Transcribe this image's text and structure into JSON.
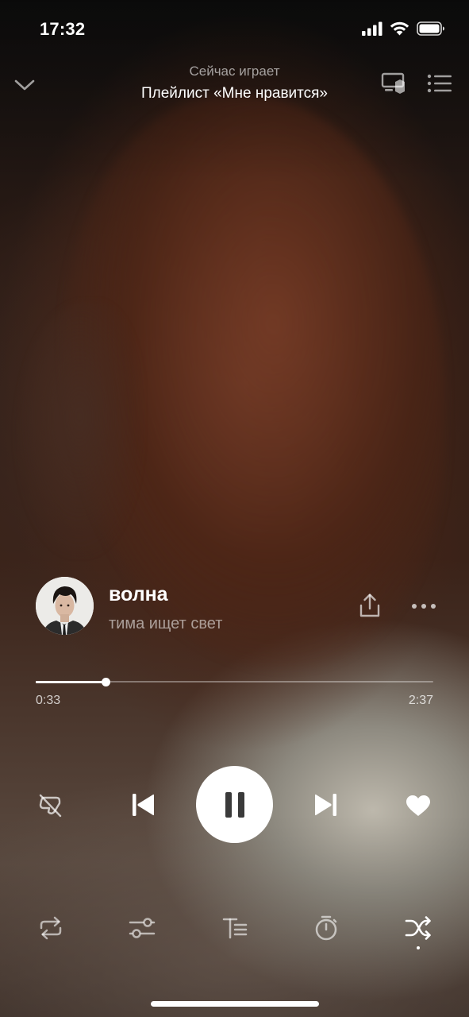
{
  "status_bar": {
    "time": "17:32",
    "icons": [
      "cellular-signal-icon",
      "wifi-icon",
      "battery-icon"
    ]
  },
  "header": {
    "subtitle": "Сейчас играет",
    "title": "Плейлист «Мне нравится»",
    "icons": [
      "chevron-down-icon",
      "device-cast-icon",
      "queue-list-icon"
    ]
  },
  "track": {
    "title": "волна",
    "artist": "тима ищет свет"
  },
  "progress": {
    "current": "0:33",
    "total": "2:37",
    "fraction": 0.175
  },
  "controls": {
    "icons": [
      "dislike-icon",
      "previous-icon",
      "pause-icon",
      "next-icon",
      "heart-icon"
    ]
  },
  "bottom_bar": {
    "icons": [
      "repeat-icon",
      "equalizer-settings-icon",
      "lyrics-icon",
      "timer-icon",
      "shuffle-icon"
    ],
    "active": "shuffle"
  },
  "colors": {
    "text_primary": "#ffffff",
    "text_secondary": "rgba(255,255,255,0.55)",
    "play_button_bg": "#ffffff",
    "play_button_icon": "#3a3a3a"
  }
}
